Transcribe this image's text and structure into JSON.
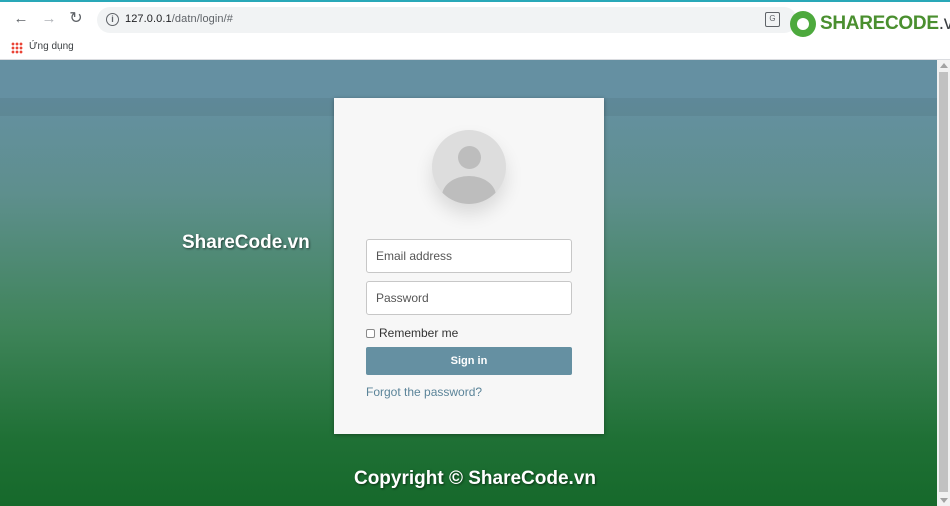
{
  "browser": {
    "url_host": "127.0.0.1",
    "url_path": "/datn/login/#",
    "bookmark_apps_label": "Ứng dụng",
    "brand_text_bold": "SHARECODE",
    "brand_text_thin": ".vn",
    "icons": {
      "back": "arrow-left-icon",
      "forward": "arrow-right-icon",
      "reload": "reload-icon",
      "info": "info-icon",
      "translate": "translate-icon",
      "apps": "apps-grid-icon"
    }
  },
  "login": {
    "email_placeholder": "Email address",
    "password_placeholder": "Password",
    "remember_label": "Remember me",
    "signin_label": "Sign in",
    "forgot_label": "Forgot the password?"
  },
  "watermark": "ShareCode.vn",
  "copyright": "Copyright © ShareCode.vn",
  "colors": {
    "accent": "#6590a2",
    "gradient_top": "#6590a2",
    "gradient_bottom": "#16692b",
    "brand_green": "#4a8f2f"
  }
}
